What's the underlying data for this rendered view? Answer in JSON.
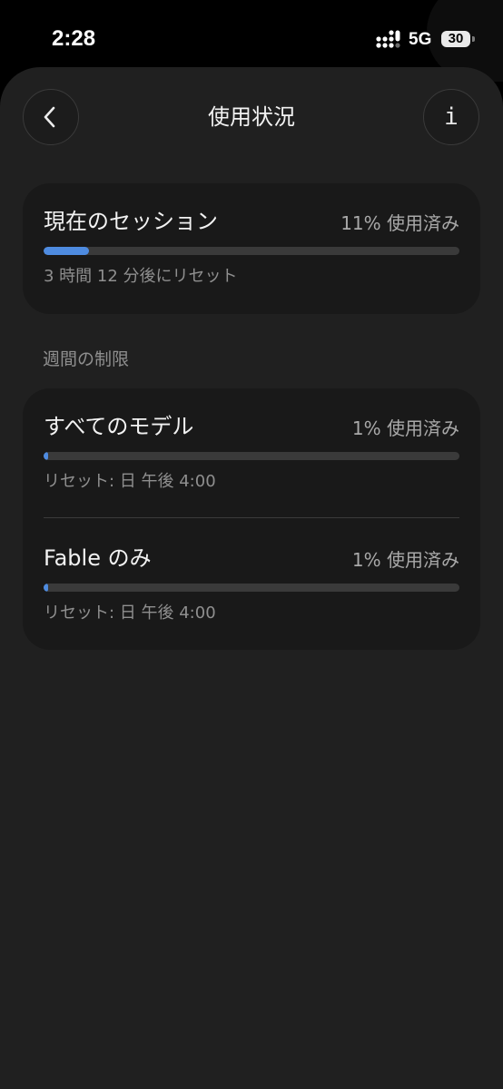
{
  "status_bar": {
    "time": "2:28",
    "network": "5G",
    "battery": "30"
  },
  "header": {
    "title": "使用状況"
  },
  "session": {
    "label": "現在のセッション",
    "percent_text": "11% 使用済み",
    "progress": 0.11,
    "reset_text": "3 時間 12 分後にリセット"
  },
  "weekly": {
    "section_label": "週間の制限",
    "items": [
      {
        "label": "すべてのモデル",
        "percent_text": "1% 使用済み",
        "progress": 0.01,
        "reset_text": "リセット: 日 午後 4:00"
      },
      {
        "label": "Fable のみ",
        "percent_text": "1% 使用済み",
        "progress": 0.01,
        "reset_text": "リセット: 日 午後 4:00"
      }
    ]
  },
  "colors": {
    "accent": "#4e8be0",
    "track": "#3a3a3a",
    "card": "#191919",
    "sheet": "#202020"
  },
  "icons": {
    "back": "chevron-left-icon",
    "info": "info-icon",
    "signal": "cellular-signal-icon",
    "battery": "battery-icon"
  }
}
